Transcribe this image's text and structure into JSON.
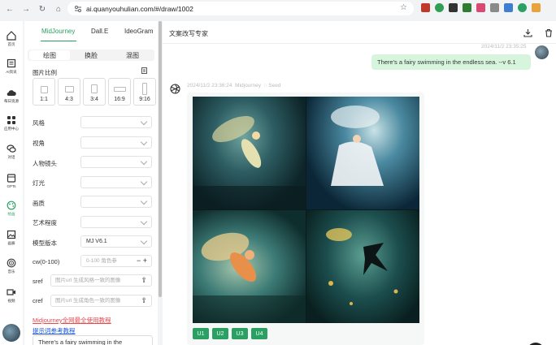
{
  "browser": {
    "url": "ai.quanyouhulian.com/#/draw/1002"
  },
  "rail": {
    "items": [
      {
        "label": "首页",
        "icon": "home-icon"
      },
      {
        "label": "AI资讯",
        "icon": "news-icon"
      },
      {
        "label": "每日资源",
        "icon": "cloud-icon"
      },
      {
        "label": "应用中心",
        "icon": "apps-icon"
      },
      {
        "label": "对话",
        "icon": "chat-icon"
      },
      {
        "label": "GPTs",
        "icon": "store-icon"
      },
      {
        "label": "绘画",
        "icon": "palette-icon"
      },
      {
        "label": "画廊",
        "icon": "gallery-icon"
      },
      {
        "label": "音乐",
        "icon": "music-icon"
      },
      {
        "label": "视频",
        "icon": "video-icon"
      }
    ]
  },
  "panel": {
    "model_tabs": [
      "MidJourney",
      "Dall.E",
      "IdeoGram"
    ],
    "mode_tabs": [
      "绘图",
      "换脸",
      "混图"
    ],
    "aspect_label": "图片比例",
    "ratios": [
      "1:1",
      "4:3",
      "3:4",
      "16:9",
      "9:16"
    ],
    "fields": [
      {
        "label": "风格",
        "value": ""
      },
      {
        "label": "视角",
        "value": ""
      },
      {
        "label": "人物镜头",
        "value": ""
      },
      {
        "label": "灯光",
        "value": ""
      },
      {
        "label": "画质",
        "value": ""
      },
      {
        "label": "艺术程度",
        "value": ""
      },
      {
        "label": "模型版本",
        "value": "MJ V6.1"
      }
    ],
    "cw": {
      "label": "cw(0-100)",
      "placeholder": "0-100 角色参"
    },
    "sref": {
      "label": "sref",
      "placeholder": "图片url 生成风格一致的图像"
    },
    "cref": {
      "label": "cref",
      "placeholder": "图片url 生成角色一致的图像"
    },
    "link_tutorial": "Midjourney全网最全使用教程",
    "link_prompt": "提示词参考教程",
    "prompt_text": "There's a fairy swimming in the"
  },
  "main": {
    "title": "文案改写专家",
    "user_time": "2024/11/2 23:35:25",
    "user_message": "There's a fairy swimming in the endless sea. --v 6.1",
    "bot_time": "2024/11/2 23:36:24",
    "bot_model": "Midjourney",
    "bot_seed": "Seed",
    "upscale_buttons": [
      "U1",
      "U2",
      "U3",
      "U4"
    ]
  },
  "colors": {
    "accent": "#2aa062",
    "bubble": "#d7f5dc",
    "link_red": "#e5484d",
    "link_blue": "#1a56db"
  }
}
